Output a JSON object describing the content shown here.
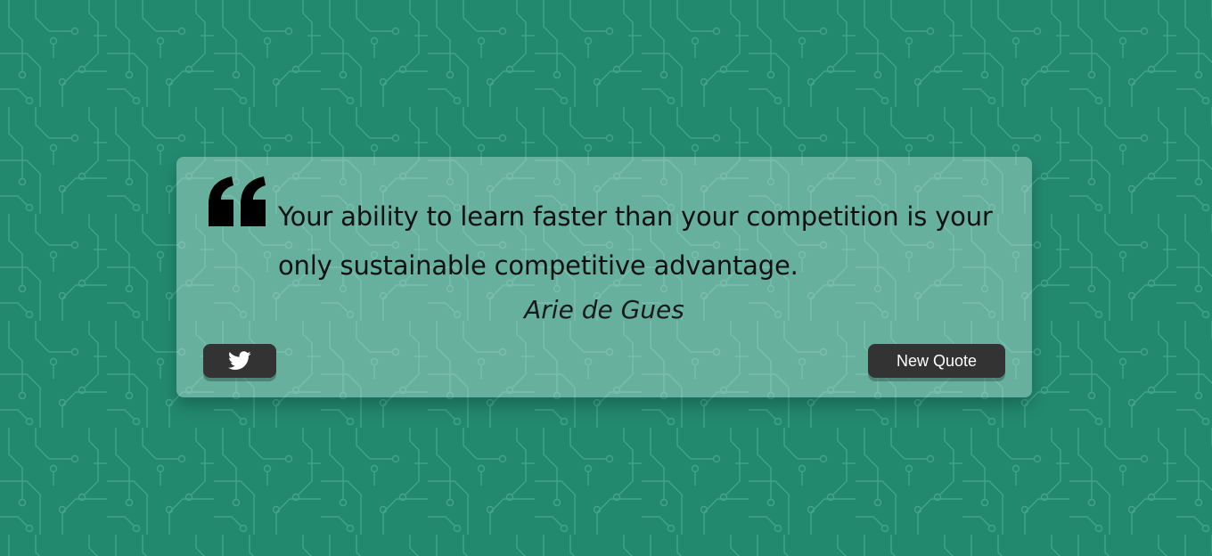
{
  "theme": {
    "background": "#22896f",
    "card": "#b4dccf",
    "button": "#333333",
    "button_text": "#ffffff",
    "text": "#111111"
  },
  "quote": {
    "text": "Your ability to learn faster than your competition is your only sustainable competitive advantage.",
    "author": "Arie de Gues",
    "icon": "quote-left-icon"
  },
  "buttons": {
    "tweet_icon": "twitter-icon",
    "new_quote_label": "New Quote"
  }
}
